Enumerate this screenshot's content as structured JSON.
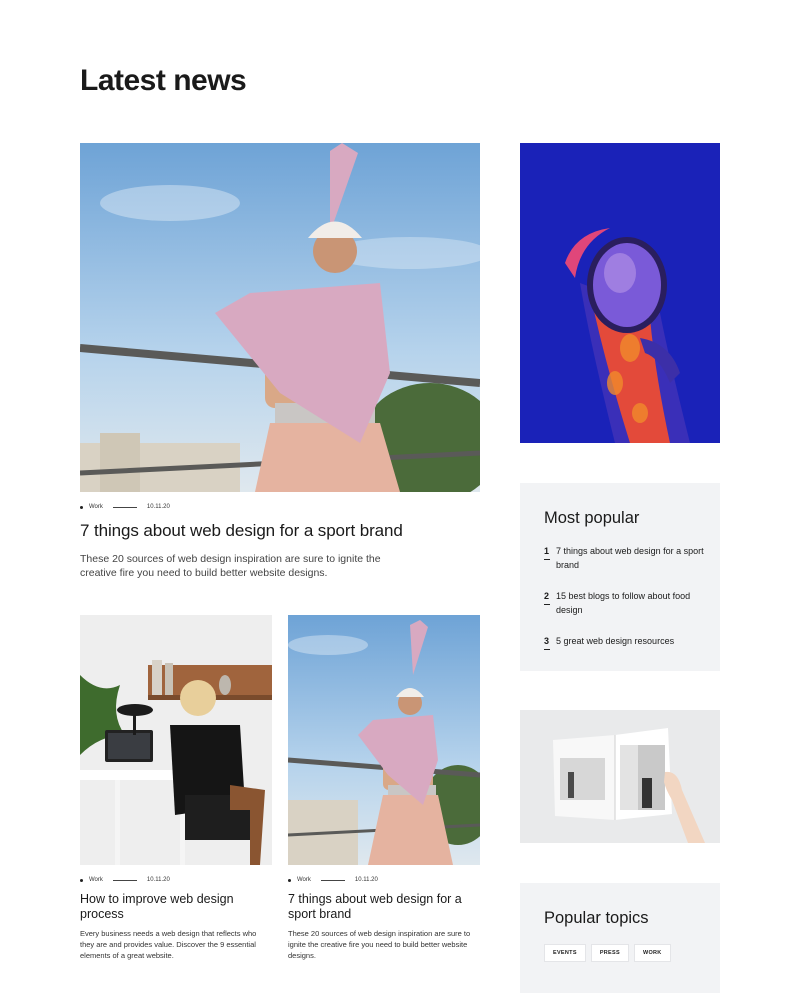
{
  "page": {
    "title": "Latest news"
  },
  "featured": {
    "category": "Work",
    "date": "10.11.20",
    "title": "7 things about web design for a sport brand",
    "excerpt": "These 20 sources of web design inspiration are sure to ignite the creative fire you need to build better website designs."
  },
  "cards": [
    {
      "category": "Work",
      "date": "10.11.20",
      "title": "How to improve web design process",
      "excerpt": "Every business needs a web design that reflects who they are and provides value. Discover the 9 essential elements of a great website."
    },
    {
      "category": "Work",
      "date": "10.11.20",
      "title": "7 things about web design for a sport brand",
      "excerpt": "These 20 sources of web design inspiration are sure to ignite the creative fire you need to build better website designs."
    }
  ],
  "most_popular": {
    "title": "Most popular",
    "items": [
      {
        "number": "1",
        "label": "7 things about web design for a sport brand"
      },
      {
        "number": "2",
        "label": "15 best blogs to follow about food design"
      },
      {
        "number": "3",
        "label": "5 great web design resources"
      }
    ]
  },
  "popular_topics": {
    "title": "Popular topics",
    "tags": [
      "EVENTS",
      "PRESS",
      "WORK"
    ]
  }
}
